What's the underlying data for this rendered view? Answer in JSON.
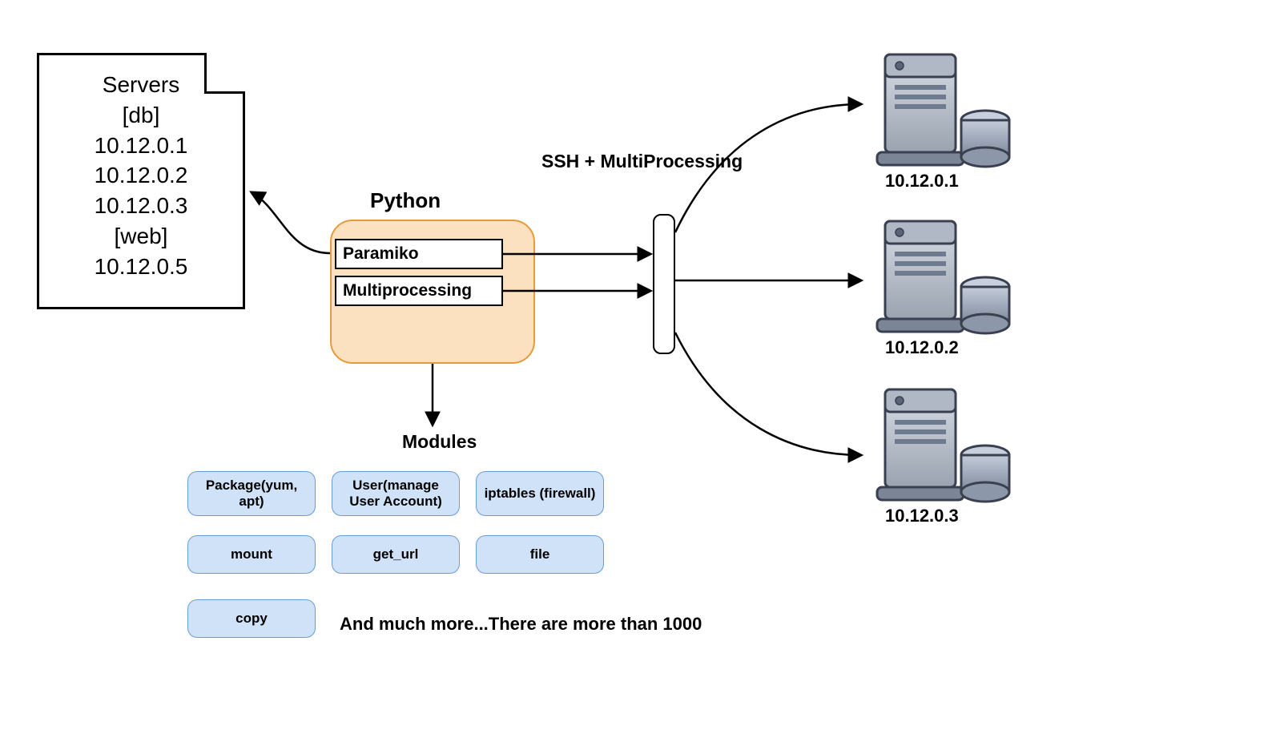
{
  "servers_doc": {
    "title": "Servers",
    "group1": "[db]",
    "ip1": "10.12.0.1",
    "ip2": "10.12.0.2",
    "ip3": "10.12.0.3",
    "group2": "[web]",
    "ip4": "10.12.0.5"
  },
  "python": {
    "title": "Python",
    "lib1": "Paramiko",
    "lib2": "Multiprocessing"
  },
  "modules": {
    "title": "Modules",
    "m1": "Package(yum, apt)",
    "m2": "User(manage User Account)",
    "m3": "iptables (firewall)",
    "m4": "mount",
    "m5": "get_url",
    "m6": "file",
    "m7": "copy",
    "more": "And much more...There are more than 1000"
  },
  "ssh_label": "SSH + MultiProcessing",
  "server_nodes": {
    "s1": "10.12.0.1",
    "s2": "10.12.0.2",
    "s3": "10.12.0.3"
  }
}
